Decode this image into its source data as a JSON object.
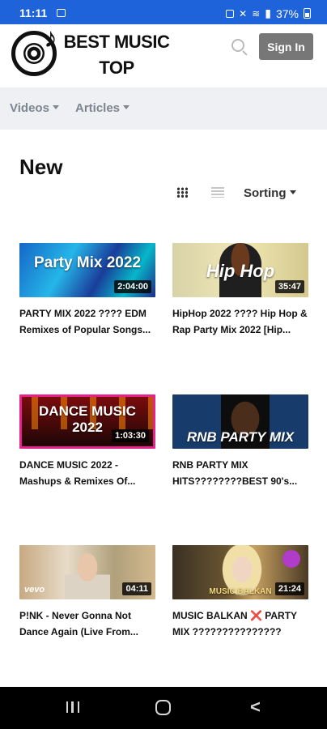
{
  "status_bar": {
    "time": "11:11",
    "battery": "37%",
    "signal_label": "LTE1"
  },
  "header": {
    "logo_text_line1": "BEST MUSIC",
    "logo_text_line2": "TOP",
    "sign_in_label": "Sign In"
  },
  "nav": {
    "items": [
      {
        "label": "Videos"
      },
      {
        "label": "Articles"
      }
    ]
  },
  "main": {
    "title": "New",
    "sorting_label": "Sorting"
  },
  "videos": [
    {
      "thumb_text": "Party Mix 2022",
      "duration": "2:04:00",
      "title": "PARTY MIX 2022 ???? EDM Remixes of Popular Songs..."
    },
    {
      "thumb_text": "Hip Hop",
      "duration": "35:47",
      "title": "HipHop 2022 ???? Hip Hop & Rap Party Mix 2022 [Hip..."
    },
    {
      "thumb_text": "DANCE MUSIC 2022",
      "duration": "1:03:30",
      "title": "DANCE MUSIC 2022 - Mashups & Remixes Of..."
    },
    {
      "thumb_text": "RNB PARTY MIX",
      "duration": "",
      "title": "RNB PARTY MIX HITS????????BEST 90's..."
    },
    {
      "thumb_text": "vevo",
      "duration": "04:11",
      "title": "P!NK - Never Gonna Not Dance Again (Live From..."
    },
    {
      "thumb_text": "MUSIC BALKAN",
      "duration": "21:24",
      "title": "MUSIC BALKAN ❌ PARTY MIX ???????????????"
    }
  ],
  "icons": {
    "search": "search-icon",
    "grid_view": "grid-view-icon",
    "list_view": "list-view-icon",
    "back": "back-icon",
    "home": "home-icon",
    "recents": "recents-icon"
  },
  "colors": {
    "status_bar": "#1e63d9",
    "nav_bg": "#eef0f4",
    "sign_in_bg": "#777777"
  }
}
